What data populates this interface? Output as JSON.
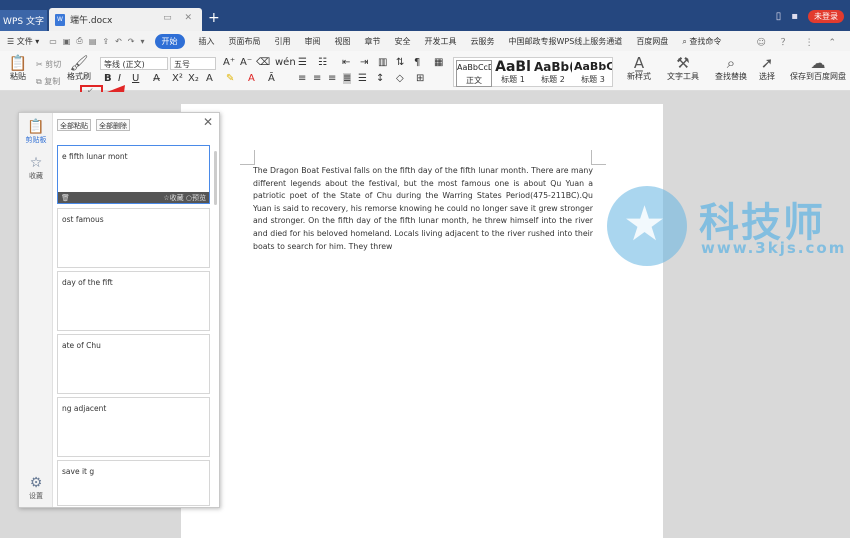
{
  "titlebar": {
    "app_tab": "WPS 文字",
    "doc_tab": "端午.docx",
    "doc_icon_text": "W",
    "new_tab": "+",
    "login": "未登录"
  },
  "menubar": {
    "file": "文件",
    "active_tab": "开始",
    "tabs": [
      "插入",
      "页面布局",
      "引用",
      "审阅",
      "视图",
      "章节",
      "安全",
      "开发工具",
      "云服务",
      "中国邮政专报WPS线上服务通道",
      "百度网盘"
    ],
    "search": "查找命令"
  },
  "ribbon": {
    "paste": "粘贴",
    "cut": "剪切",
    "copy": "复制",
    "format_painter": "格式刷",
    "font_name": "等线 (正文)",
    "font_size": "五号",
    "bold": "B",
    "italic": "I",
    "underline": "U",
    "styles": [
      {
        "preview": "AaBbCcDd",
        "label": "正文"
      },
      {
        "preview": "AaBl",
        "label": "标题 1"
      },
      {
        "preview": "AaBb(",
        "label": "标题 2"
      },
      {
        "preview": "AaBbC",
        "label": "标题 3"
      }
    ],
    "new_style": "新样式",
    "text_tools": "文字工具",
    "find_replace": "查找替换",
    "select": "选择",
    "save_baidu": "保存到百度网盘"
  },
  "clipboard": {
    "side": {
      "clipboard": "剪贴板",
      "favorites": "收藏",
      "settings": "设置"
    },
    "paste_all": "全部粘贴",
    "delete_all": "全部删除",
    "item_actions": {
      "favorite": "收藏",
      "preview": "预览"
    },
    "items": [
      "e fifth lunar mont",
      "ost famous",
      " day of the fift",
      "ate of Chu",
      "ng adjacent",
      "save it g"
    ]
  },
  "document": {
    "text": "The Dragon Boat Festival falls on the fifth day of the fifth lunar month. There are many different legends about the festival, but the most famous one is about Qu Yuan a patriotic poet of the State of Chu during the Warring States Period(475-211BC).Qu Yuan is said to recovery, his remorse knowing he could no longer save it grew stronger and stronger. On the fifth day of the fifth lunar month, he threw himself into the river and died for his beloved homeland. Locals living adjacent to the river rushed into their boats to search for him. They threw"
  },
  "watermark": {
    "title": "科技师",
    "url": "www.3kjs.com"
  },
  "colors": {
    "titlebar": "#25477f",
    "accent": "#2f6fd6",
    "highlight_box": "#e12626",
    "watermark": "#64b4e1"
  }
}
